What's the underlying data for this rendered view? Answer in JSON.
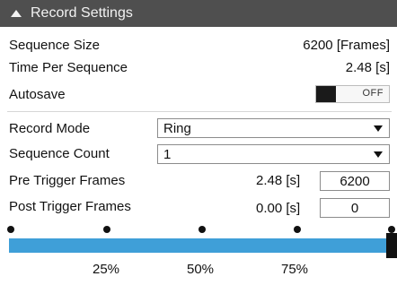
{
  "header": {
    "title": "Record Settings"
  },
  "rows": {
    "sequence_size": {
      "label": "Sequence Size",
      "value": "6200 [Frames]"
    },
    "time_per_sequence": {
      "label": "Time Per Sequence",
      "value": "2.48 [s]"
    },
    "autosave": {
      "label": "Autosave",
      "state": "OFF"
    },
    "record_mode": {
      "label": "Record Mode",
      "value": "Ring"
    },
    "sequence_count": {
      "label": "Sequence Count",
      "value": "1"
    },
    "pre_trigger": {
      "label": "Pre Trigger Frames",
      "time": "2.48 [s]",
      "frames": "6200"
    },
    "post_trigger": {
      "label": "Post Trigger Frames",
      "time": "0.00 [s]",
      "frames": "0"
    }
  },
  "slider": {
    "ticks": [
      "25%",
      "50%",
      "75%"
    ],
    "level_percent": 100
  },
  "colors": {
    "header_bg": "#4f4f4f",
    "track": "#3f9fd8"
  }
}
